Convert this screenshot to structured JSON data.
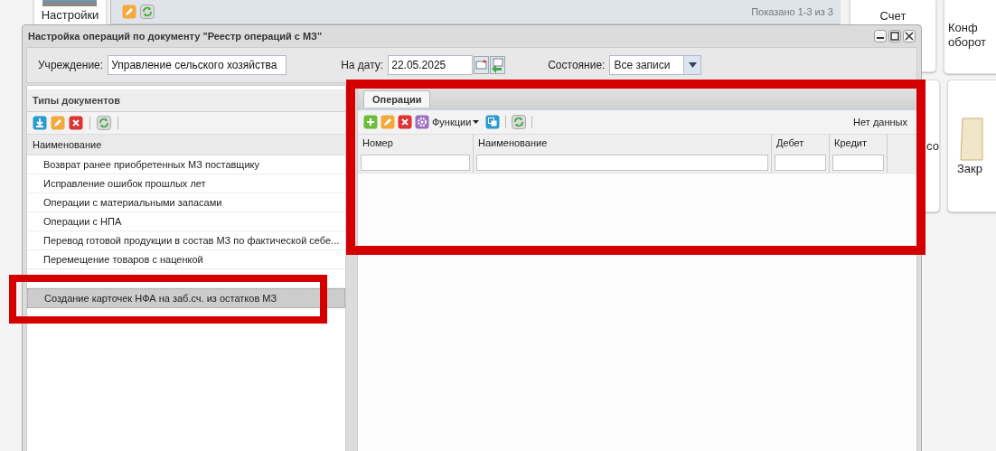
{
  "background": {
    "left_tile": "Настройки",
    "grid_status": "Показано 1-3 из 3",
    "tiles": [
      {
        "lines": [
          "Счет"
        ]
      },
      {
        "lines": [
          "Конф",
          "оборот"
        ]
      },
      {
        "lines": [
          "со"
        ]
      },
      {
        "lines": [
          "Закр"
        ]
      }
    ]
  },
  "window": {
    "title": "Настройка операций по документу \"Реестр операций с МЗ\"",
    "institution": {
      "label": "Учреждение:",
      "value": "Управление сельского хозяйства"
    },
    "date": {
      "label": "На дату:",
      "value": "22.05.2025"
    },
    "state": {
      "label": "Состояние:",
      "value": "Все записи"
    },
    "doc_types": {
      "title": "Типы документов",
      "column": "Наименование",
      "rows": [
        {
          "name": "Возврат ранее приобретенных МЗ поставщику",
          "selected": false
        },
        {
          "name": "Исправление ошибок прошлых лет",
          "selected": false
        },
        {
          "name": "Операции с материальными запасами",
          "selected": false
        },
        {
          "name": "Операции с НПА",
          "selected": false
        },
        {
          "name": "Перевод готовой продукции в состав МЗ по фактической себе...",
          "selected": false
        },
        {
          "name": "Перемещение товаров с наценкой",
          "selected": false
        },
        {
          "name": "Создание карточек НФА на заб.сч. из остатков МЗ",
          "selected": true
        }
      ]
    },
    "operations": {
      "tabs": [
        {
          "label": "Операции",
          "selected": true
        }
      ],
      "functions": "Функции",
      "status": "Нет данных",
      "columns": [
        "Номер",
        "Наименование",
        "Дебет",
        "Кредит"
      ]
    }
  }
}
